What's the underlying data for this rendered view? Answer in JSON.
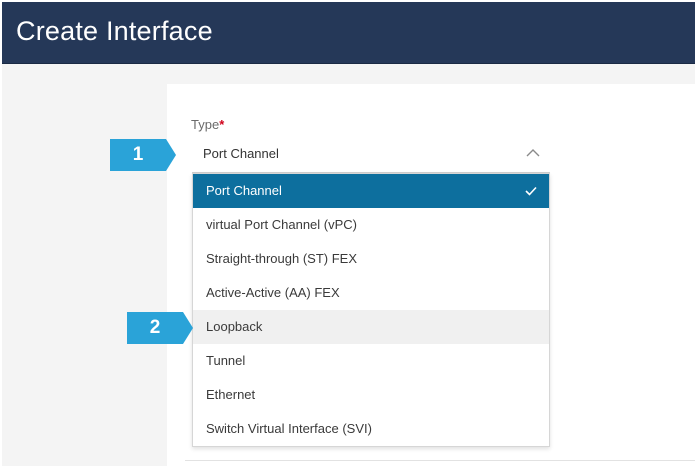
{
  "header": {
    "title": "Create Interface"
  },
  "form": {
    "type_label": "Type",
    "required_marker": "*",
    "selected_value": "Port Channel"
  },
  "dropdown": {
    "options": [
      {
        "label": "Port Channel",
        "state": "selected"
      },
      {
        "label": "virtual Port Channel (vPC)",
        "state": "normal"
      },
      {
        "label": "Straight-through (ST) FEX",
        "state": "normal"
      },
      {
        "label": "Active-Active (AA) FEX",
        "state": "normal"
      },
      {
        "label": "Loopback",
        "state": "hover"
      },
      {
        "label": "Tunnel",
        "state": "normal"
      },
      {
        "label": "Ethernet",
        "state": "normal"
      },
      {
        "label": "Switch Virtual Interface (SVI)",
        "state": "normal"
      }
    ]
  },
  "callouts": [
    {
      "number": "1"
    },
    {
      "number": "2"
    }
  ],
  "colors": {
    "header_bg": "#253858",
    "selected_bg": "#0d6f9e",
    "hover_bg": "#f0f0f0",
    "callout_bg": "#2aa3d8",
    "required": "#d0021b"
  }
}
